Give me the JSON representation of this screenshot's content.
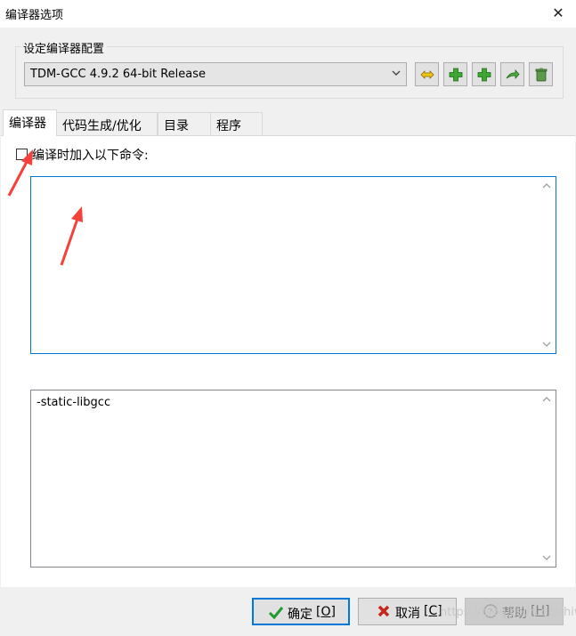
{
  "window": {
    "title": "编译器选项",
    "close_glyph": "✕"
  },
  "config_group": {
    "title": "设定编译器配置",
    "selected_profile": "TDM-GCC 4.9.2 64-bit Release",
    "toolbar_icons": [
      "rename-icon",
      "add-profile-icon",
      "add-profile-copy-icon",
      "export-icon",
      "delete-icon"
    ]
  },
  "tabs": [
    {
      "label": "编译器",
      "active": true
    },
    {
      "label": "代码生成/优化",
      "active": false
    },
    {
      "label": "目录",
      "active": false
    },
    {
      "label": "程序",
      "active": false
    }
  ],
  "compiler_tab": {
    "add_commands_checkbox": {
      "label": "编译时加入以下命令:",
      "checked": false
    },
    "compile_commands_text": "",
    "linker_commands_text": "-static-libgcc"
  },
  "buttons": {
    "ok": {
      "label": "确定",
      "accel": "[O]"
    },
    "cancel": {
      "label": "取消",
      "accel": "[C]"
    },
    "help": {
      "label": "帮助",
      "accel": "[H]"
    }
  },
  "watermark": "https://blog.csdn.net/hiww",
  "colors": {
    "accent": "#0078d7",
    "annotation_red": "#f5413b"
  }
}
